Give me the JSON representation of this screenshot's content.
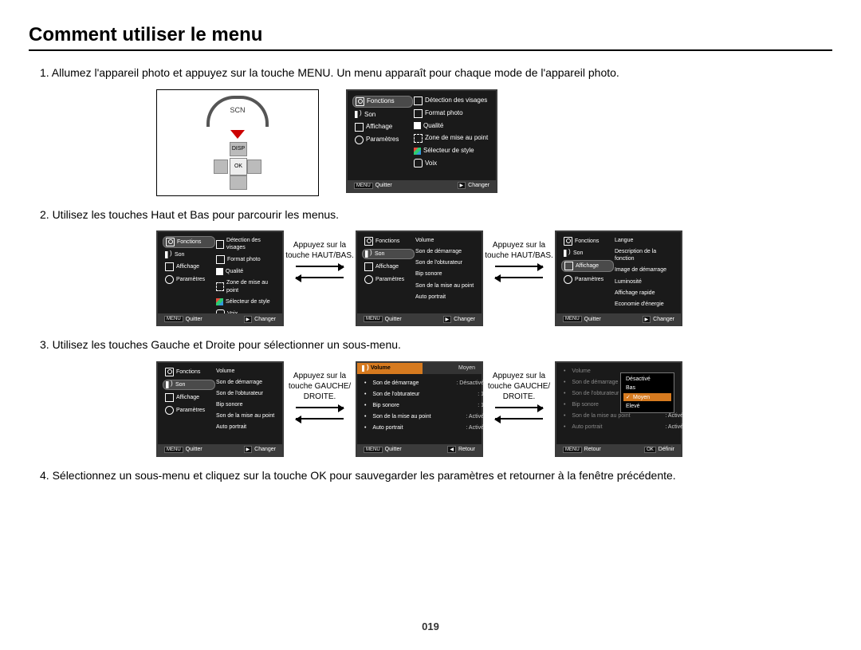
{
  "title": "Comment utiliser le menu",
  "page_number": "019",
  "steps": {
    "s1": "1. Allumez l'appareil photo et appuyez sur la touche MENU.  Un menu apparaît pour chaque mode de l'appareil photo.",
    "s2": "2. Utilisez les touches Haut et Bas pour parcourir les menus.",
    "s3": "3. Utilisez les touches Gauche et Droite pour sélectionner un sous-menu.",
    "s4": "4. Sélectionnez un sous-menu et cliquez sur la touche OK pour sauvegarder les paramètres et retourner à la fenêtre précédente."
  },
  "camera_labels": {
    "dial": "SCN",
    "disp": "DISP",
    "ok": "OK"
  },
  "left_menu_items": [
    "Fonctions",
    "Son",
    "Affichage",
    "Paramètres"
  ],
  "right_menu_fonctions": [
    "Détection des visages",
    "Format photo",
    "Qualité",
    "Zone de mise au point",
    "Sélecteur de style",
    "Voix"
  ],
  "right_menu_son": [
    "Volume",
    "Son de démarrage",
    "Son de l'obturateur",
    "Bip sonore",
    "Son de la mise au point",
    "Auto portrait"
  ],
  "right_menu_affichage": [
    "Langue",
    "Description de la fonction",
    "Image de démarrage",
    "Luminosité",
    "Affichage rapide",
    "Economie d'énergie"
  ],
  "son_values": {
    "volume": "Moyen",
    "demarrage": ": Désactivé",
    "obtur": ": 1",
    "bip": ": 1",
    "map": ": Activé",
    "auto": ": Activé"
  },
  "vol_options": [
    "Désactivé",
    "Bas",
    "Moyen",
    "Elevé"
  ],
  "vol_selected": "Moyen",
  "between_ud": "Appuyez sur la touche HAUT/BAS.",
  "between_lr": "Appuyez sur la touche GAUCHE/ DROITE.",
  "footer": {
    "quitter": "Quitter",
    "changer": "Changer",
    "retour": "Retour",
    "definir": "Définir",
    "menu": "MENU"
  }
}
